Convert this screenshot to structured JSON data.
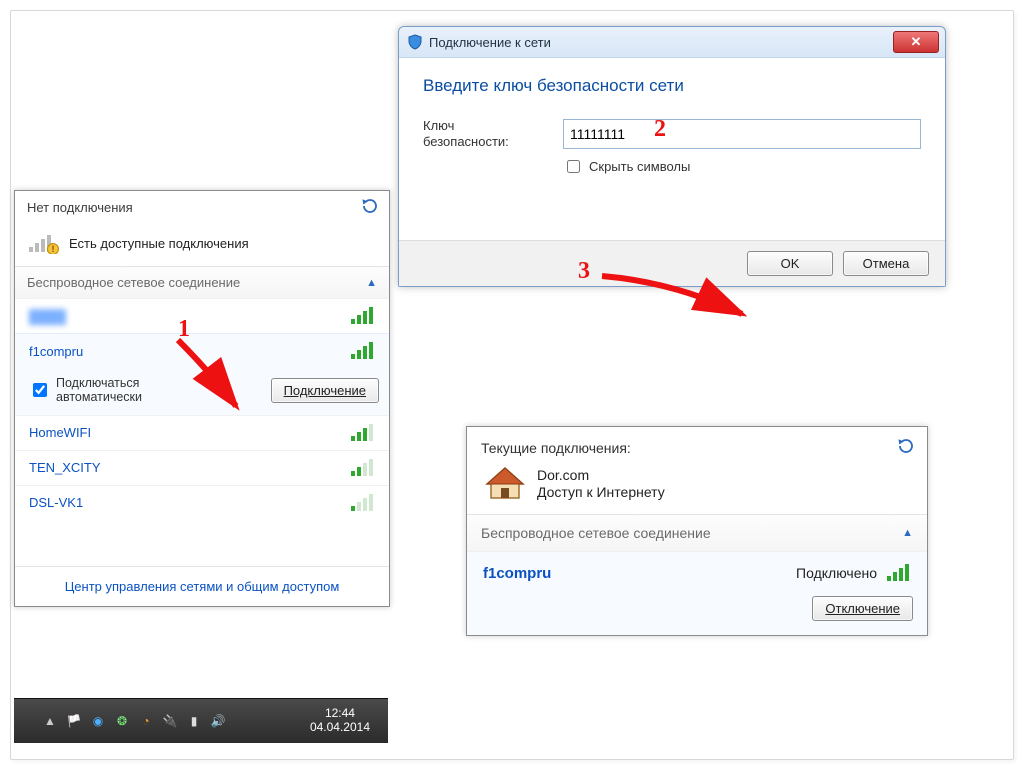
{
  "wifi_panel": {
    "header": "Нет подключения",
    "status_text": "Есть доступные подключения",
    "section_title": "Беспроводное сетевое соединение",
    "networks": [
      {
        "name": "",
        "blurred": true
      },
      {
        "name": "f1compru",
        "selected": true
      },
      {
        "name": "HomeWIFI"
      },
      {
        "name": "TEN_XCITY"
      },
      {
        "name": "DSL-VK1"
      }
    ],
    "auto_connect_label": "Подключаться\nавтоматически",
    "connect_button": "Подключение",
    "footer_link": "Центр управления сетями и общим доступом"
  },
  "taskbar": {
    "time": "12:44",
    "date": "04.04.2014"
  },
  "dialog": {
    "title": "Подключение к сети",
    "heading": "Введите ключ безопасности сети",
    "key_label": "Ключ\nбезопасности:",
    "key_value": "11111111",
    "hide_chars_label": "Скрыть символы",
    "ok": "OK",
    "cancel": "Отмена"
  },
  "conn_panel": {
    "header": "Текущие подключения:",
    "net_name": "Dor.com",
    "net_status": "Доступ к Интернету",
    "section_title": "Беспроводное сетевое соединение",
    "connected_net": "f1compru",
    "connected_status": "Подключено",
    "disconnect": "Отключение"
  },
  "annotations": {
    "n1": "1",
    "n2": "2",
    "n3": "3"
  }
}
